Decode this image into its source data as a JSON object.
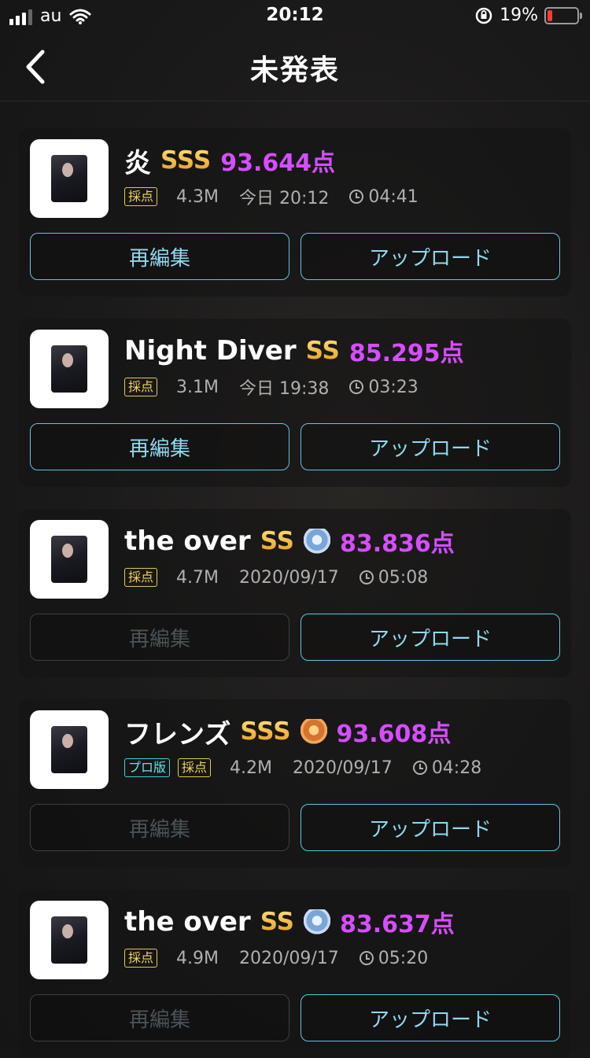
{
  "status": {
    "carrier": "au",
    "time": "20:12",
    "battery_percent": "19%",
    "battery_level": 0.19
  },
  "nav": {
    "title": "未発表"
  },
  "buttons": {
    "edit_label": "再編集",
    "upload_label": "アップロード"
  },
  "cards": [
    {
      "title": "炎",
      "rank": "SSS",
      "medal": null,
      "score": "93.644点",
      "tags": [
        "採点"
      ],
      "size": "4.3M",
      "date": "今日 20:12",
      "duration": "04:41",
      "edit_enabled": true
    },
    {
      "title": "Night Diver",
      "rank": "SS",
      "medal": null,
      "score": "85.295点",
      "tags": [
        "採点"
      ],
      "size": "3.1M",
      "date": "今日 19:38",
      "duration": "03:23",
      "edit_enabled": true
    },
    {
      "title": "the over",
      "rank": "SS",
      "medal": "silver-medal-icon",
      "score": "83.836点",
      "tags": [
        "採点"
      ],
      "size": "4.7M",
      "date": "2020/09/17",
      "duration": "05:08",
      "edit_enabled": false
    },
    {
      "title": "フレンズ",
      "rank": "SSS",
      "medal": "bronze-medal-icon",
      "score": "93.608点",
      "tags": [
        "プロ版",
        "採点"
      ],
      "size": "4.2M",
      "date": "2020/09/17",
      "duration": "04:28",
      "edit_enabled": false
    },
    {
      "title": "the over",
      "rank": "SS",
      "medal": "silver-medal-icon",
      "score": "83.637点",
      "tags": [
        "採点"
      ],
      "size": "4.9M",
      "date": "2020/09/17",
      "duration": "05:20",
      "edit_enabled": false
    }
  ],
  "colors": {
    "score": "#d64dff",
    "rank": "#f0b428",
    "button_border": "#63c4e0",
    "tag_score": "#e7c84b",
    "tag_pro": "#3fd1d6"
  }
}
